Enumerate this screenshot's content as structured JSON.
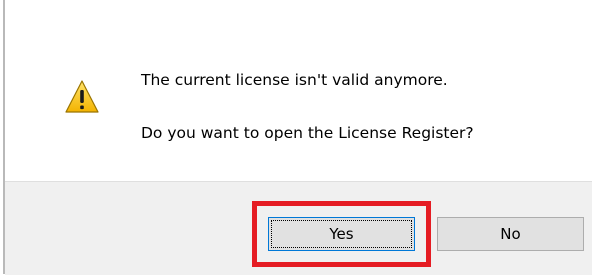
{
  "dialog": {
    "message_line1": "The current license isn't valid anymore.",
    "message_line2": "Do you want to open the License Register?",
    "icon": "warning-icon",
    "buttons": {
      "yes_label": "Yes",
      "no_label": "No"
    }
  },
  "colors": {
    "highlight": "#e51c23",
    "button_bar": "#f0f0f0",
    "focus_border": "#0078d7",
    "warning_fill": "#f6c400"
  }
}
